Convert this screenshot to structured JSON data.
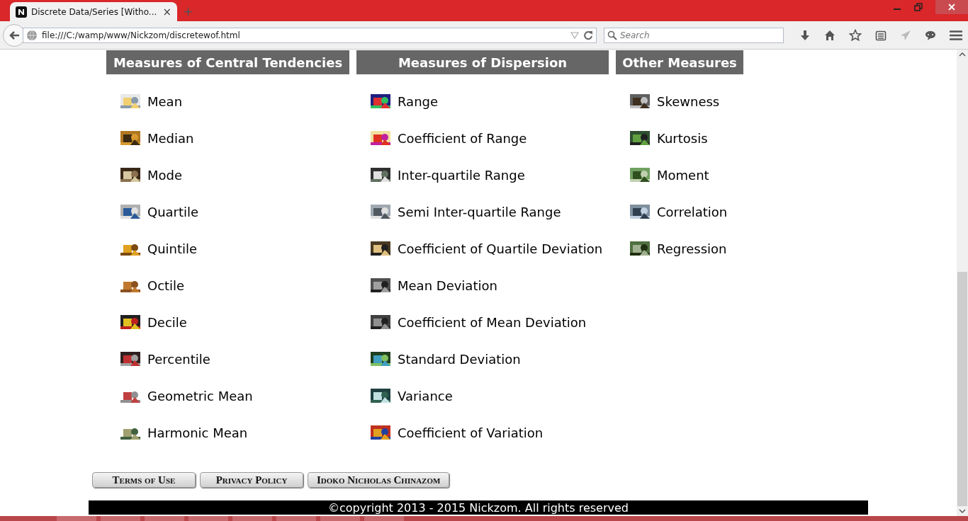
{
  "browser": {
    "tab_title": "Discrete Data/Series [Witho...",
    "tab_close": "×",
    "new_tab": "+",
    "url": "file:///C:/wamp/www/Nickzom/discretewof.html",
    "search": {
      "placeholder": "Search"
    }
  },
  "columns": [
    {
      "heading": "Measures of Central Tendencies",
      "items": [
        "Mean",
        "Median",
        "Mode",
        "Quartile",
        "Quintile",
        "Octile",
        "Decile",
        "Percentile",
        "Geometric Mean",
        "Harmonic Mean"
      ]
    },
    {
      "heading": "Measures of Dispersion",
      "items": [
        "Range",
        "Coefficient of Range",
        "Inter-quartile Range",
        "Semi Inter-quartile Range",
        "Coefficient of Quartile Deviation",
        "Mean Deviation",
        "Coefficient of Mean Deviation",
        "Standard Deviation",
        "Variance",
        "Coefficient of Variation"
      ]
    },
    {
      "heading": "Other Measures",
      "items": [
        "Skewness",
        "Kurtosis",
        "Moment",
        "Correlation",
        "Regression"
      ]
    }
  ],
  "footer_links": [
    "Terms of Use",
    "Privacy Policy",
    "Idoko Nicholas Chinazom"
  ],
  "copyright": "©copyright 2013 - 2015 Nickzom. All rights reserved"
}
